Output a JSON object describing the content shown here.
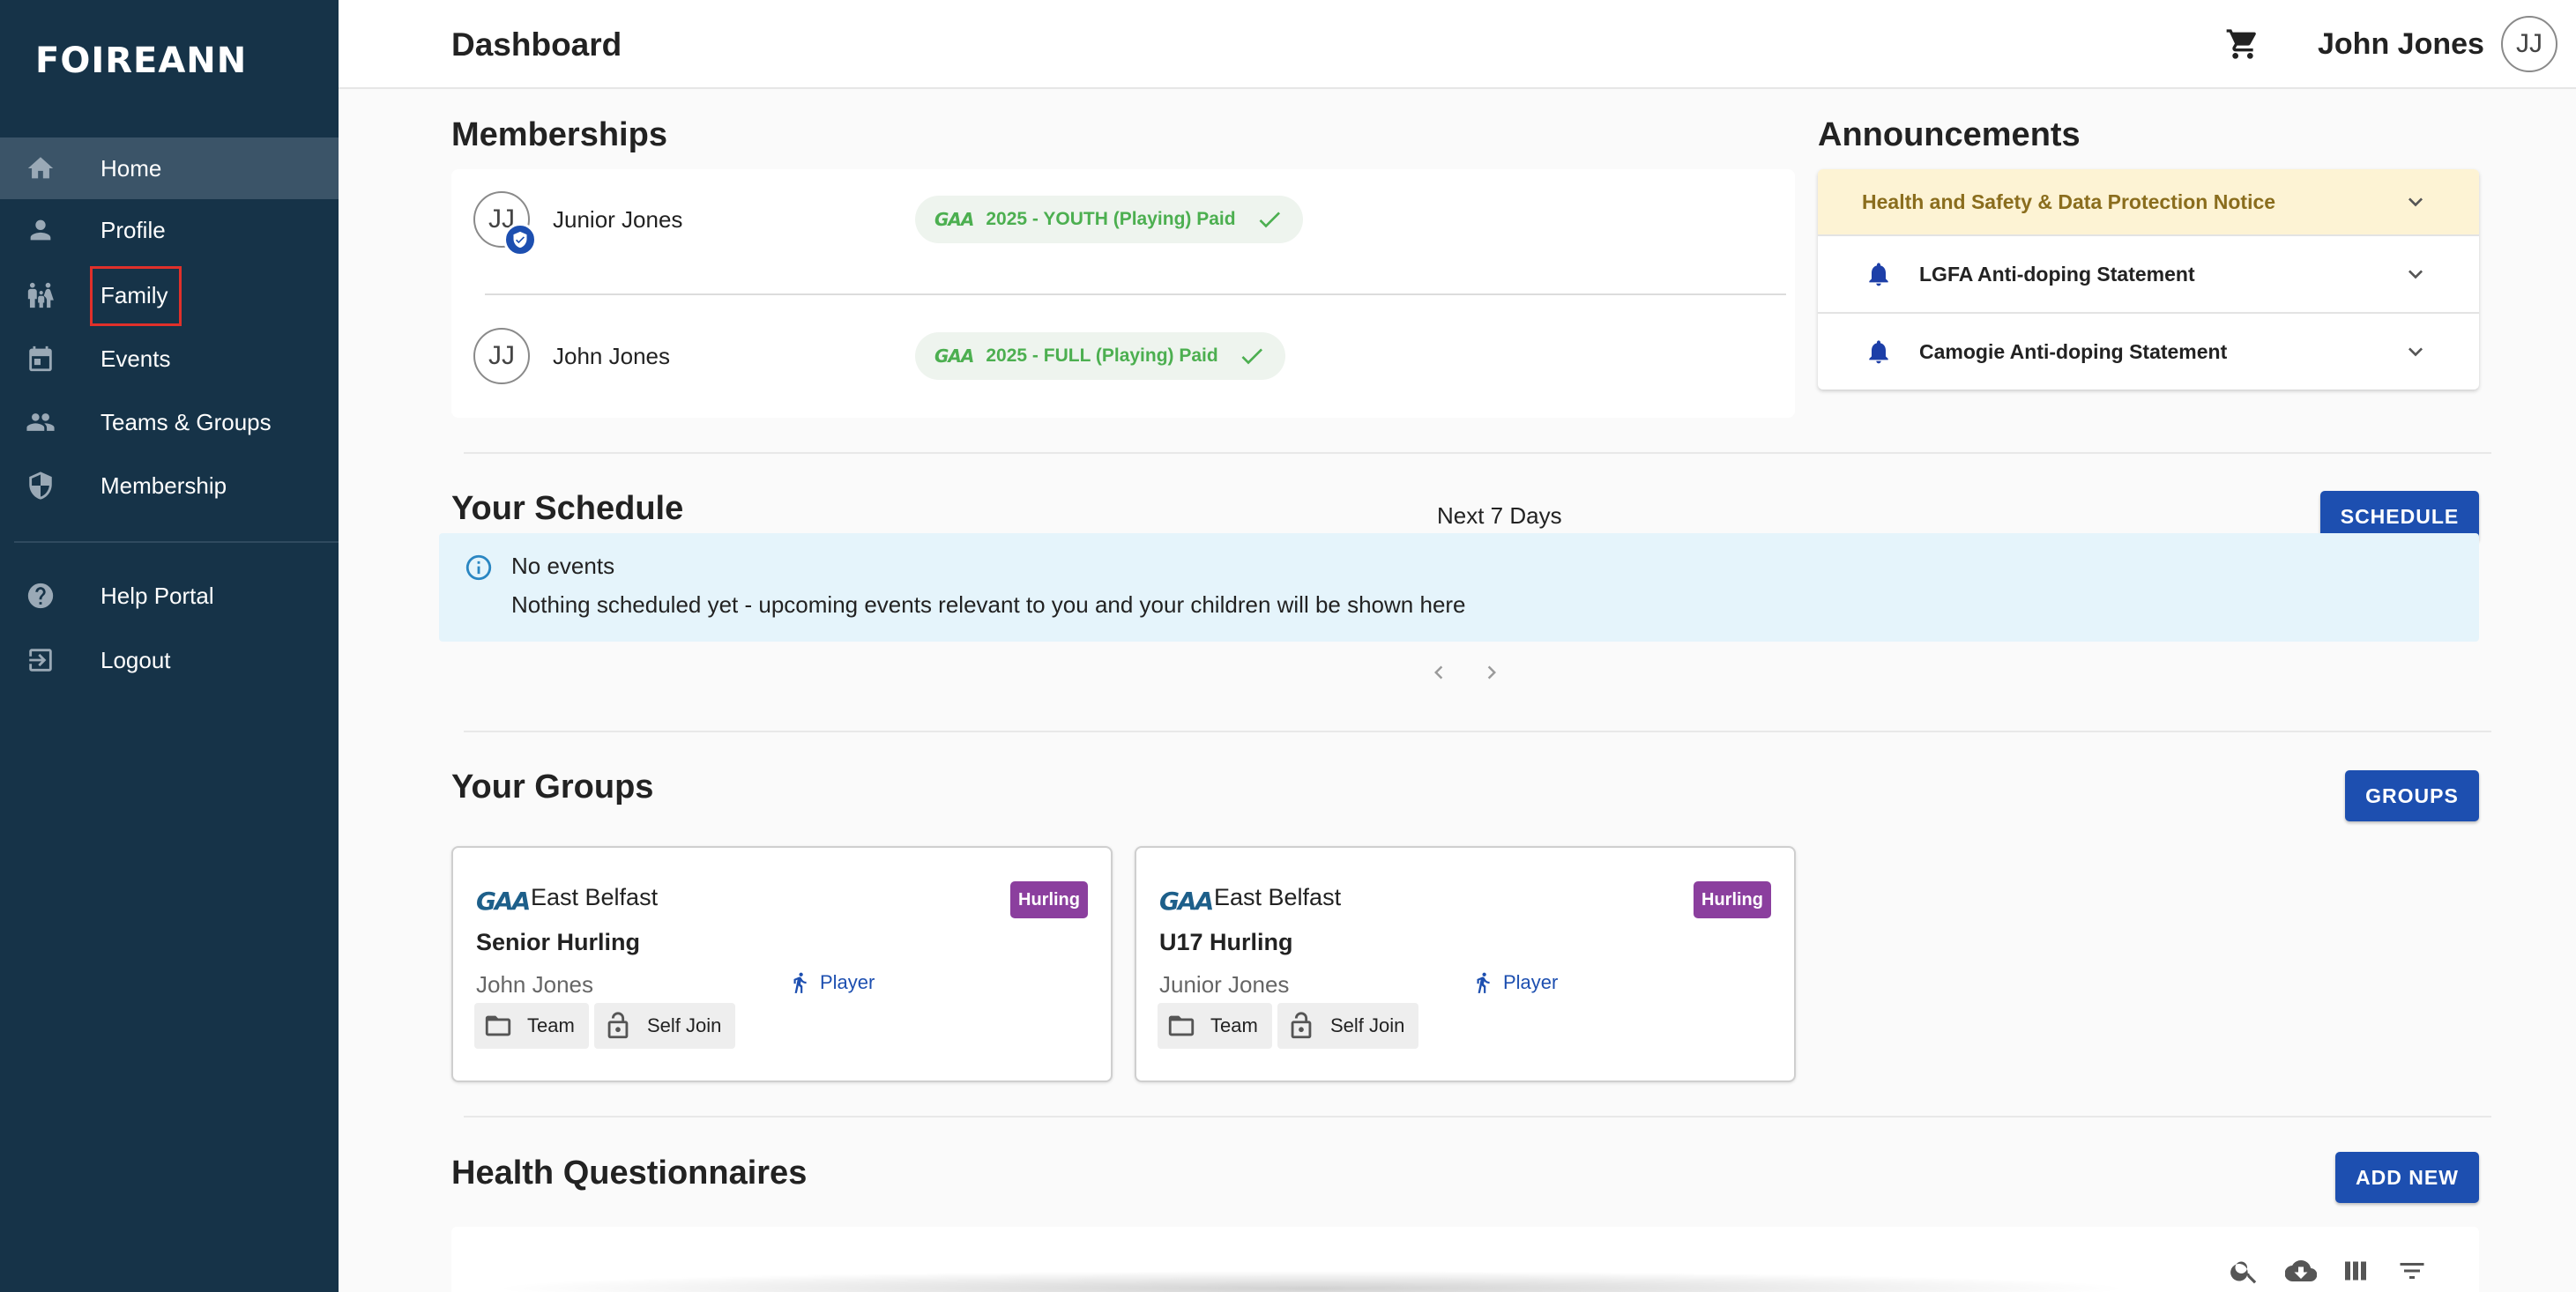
{
  "app": {
    "logo": "FOIREANN"
  },
  "sidebar": {
    "items": [
      {
        "label": "Home",
        "icon": "home-icon"
      },
      {
        "label": "Profile",
        "icon": "person-icon"
      },
      {
        "label": "Family",
        "icon": "family-icon"
      },
      {
        "label": "Events",
        "icon": "calendar-icon"
      },
      {
        "label": "Teams & Groups",
        "icon": "group-icon"
      },
      {
        "label": "Membership",
        "icon": "shield-icon"
      },
      {
        "label": "Help Portal",
        "icon": "help-icon"
      },
      {
        "label": "Logout",
        "icon": "logout-icon"
      }
    ],
    "active": "Home",
    "highlighted": "Family"
  },
  "header": {
    "title": "Dashboard",
    "user_name": "John Jones",
    "user_initials": "JJ"
  },
  "memberships": {
    "title": "Memberships",
    "rows": [
      {
        "initials": "JJ",
        "name": "Junior Jones",
        "chip_logo": "GAA",
        "status": "2025 - YOUTH (Playing) Paid"
      },
      {
        "initials": "JJ",
        "name": "John Jones",
        "chip_logo": "GAA",
        "status": "2025 - FULL (Playing) Paid"
      }
    ]
  },
  "announcements": {
    "title": "Announcements",
    "items": [
      {
        "title": "Health and Safety & Data Protection Notice"
      },
      {
        "title": "LGFA Anti-doping Statement"
      },
      {
        "title": "Camogie Anti-doping Statement"
      }
    ]
  },
  "schedule": {
    "title": "Your Schedule",
    "range": "Next 7 Days",
    "button": "SCHEDULE",
    "empty_title": "No events",
    "empty_text": "Nothing scheduled yet - upcoming events relevant to you and your children will be shown here"
  },
  "groups": {
    "title": "Your Groups",
    "button": "GROUPS",
    "cards": [
      {
        "logo": "GAA",
        "club": "East Belfast",
        "sport": "Hurling",
        "name": "Senior Hurling",
        "member": "John Jones",
        "role": "Player",
        "tags": [
          "Team",
          "Self Join"
        ]
      },
      {
        "logo": "GAA",
        "club": "East Belfast",
        "sport": "Hurling",
        "name": "U17 Hurling",
        "member": "Junior Jones",
        "role": "Player",
        "tags": [
          "Team",
          "Self Join"
        ]
      }
    ]
  },
  "health": {
    "title": "Health Questionnaires",
    "button": "ADD NEW"
  },
  "colors": {
    "sidebar_bg": "#163348",
    "primary": "#1d4fb0",
    "paid_green": "#4caf50",
    "hurling_badge": "#8b3f9e",
    "notice_bg": "#fdf3d4",
    "info_bg": "#e5f4fb"
  }
}
